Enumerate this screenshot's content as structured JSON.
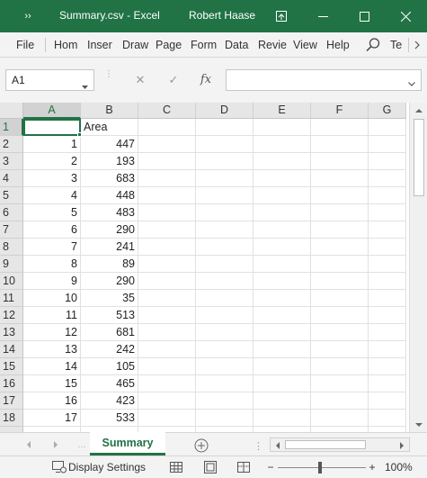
{
  "window": {
    "qat_glyph": "››",
    "title": "Summary.csv  -  Excel",
    "user": "Robert Haase"
  },
  "ribbon": {
    "tabs": [
      "File",
      "Hom",
      "Inser",
      "Draw",
      "Page",
      "Form",
      "Data",
      "Revie",
      "View",
      "Help",
      "Te"
    ]
  },
  "formula_bar": {
    "name_box": "A1",
    "cancel_glyph": "✕",
    "enter_glyph": "✓",
    "fx_label": "fx",
    "formula": ""
  },
  "grid": {
    "columns": [
      "A",
      "B",
      "C",
      "D",
      "E",
      "F",
      "G"
    ],
    "selected_cell": "A1",
    "rows": [
      {
        "n": "1",
        "a": "",
        "b": "Area"
      },
      {
        "n": "2",
        "a": "1",
        "b": "447"
      },
      {
        "n": "3",
        "a": "2",
        "b": "193"
      },
      {
        "n": "4",
        "a": "3",
        "b": "683"
      },
      {
        "n": "5",
        "a": "4",
        "b": "448"
      },
      {
        "n": "6",
        "a": "5",
        "b": "483"
      },
      {
        "n": "7",
        "a": "6",
        "b": "290"
      },
      {
        "n": "8",
        "a": "7",
        "b": "241"
      },
      {
        "n": "9",
        "a": "8",
        "b": "89"
      },
      {
        "n": "10",
        "a": "9",
        "b": "290"
      },
      {
        "n": "11",
        "a": "10",
        "b": "35"
      },
      {
        "n": "12",
        "a": "11",
        "b": "513"
      },
      {
        "n": "13",
        "a": "12",
        "b": "681"
      },
      {
        "n": "14",
        "a": "13",
        "b": "242"
      },
      {
        "n": "15",
        "a": "14",
        "b": "105"
      },
      {
        "n": "16",
        "a": "15",
        "b": "465"
      },
      {
        "n": "17",
        "a": "16",
        "b": "423"
      },
      {
        "n": "18",
        "a": "17",
        "b": "533"
      }
    ]
  },
  "sheets": {
    "active": "Summary"
  },
  "status": {
    "display_settings": "Display Settings",
    "zoom": "100%",
    "zoom_minus": "−",
    "zoom_plus": "+"
  },
  "colors": {
    "accent": "#217346",
    "titlebar_text": "#ffffff"
  }
}
